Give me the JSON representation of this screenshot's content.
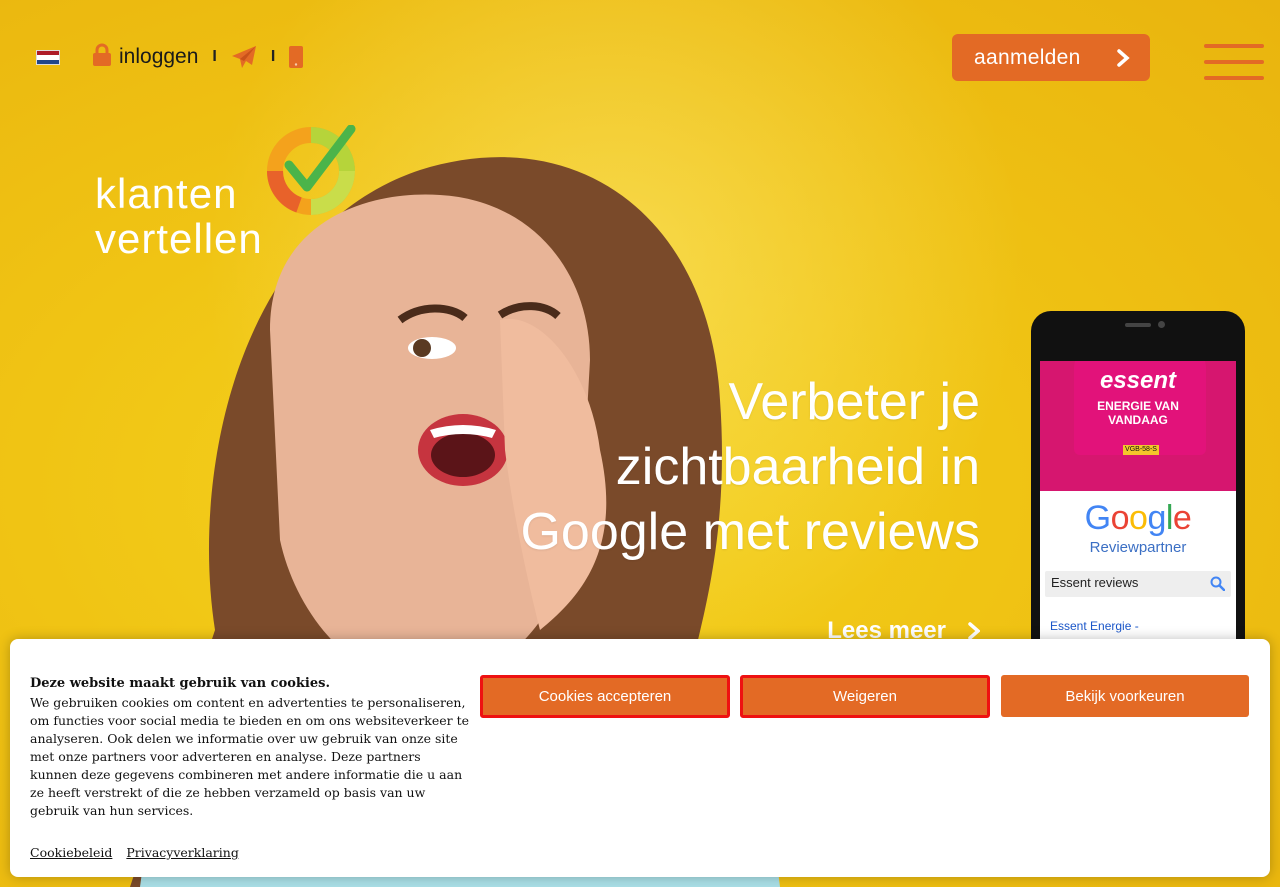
{
  "header": {
    "language_flag": "nl-flag",
    "login_label": "inloggen",
    "separator": "I",
    "signup_label": "aanmelden",
    "accent_color": "#e36a25"
  },
  "logo": {
    "word1": "klanten",
    "word2": "vertellen"
  },
  "hero": {
    "headline_lines": [
      "Verbeter je",
      "zichtbaarheid in",
      "Google met reviews"
    ],
    "read_more_label": "Lees meer"
  },
  "phone": {
    "brand": "essent",
    "tagline_line1": "ENERGIE VAN",
    "tagline_line2": "VANDAAG",
    "plate": "VGB-58-S",
    "google_letters": [
      "G",
      "o",
      "o",
      "g",
      "l",
      "e"
    ],
    "reviewpartner": "Reviewpartner",
    "search_query": "Essent reviews",
    "result": "Essent Energie -"
  },
  "cookie": {
    "title": "Deze website maakt gebruik van cookies.",
    "body": "We gebruiken cookies om content en advertenties te personaliseren, om functies voor social media te bieden en om ons websiteverkeer te analyseren. Ook delen we informatie over uw gebruik van onze site met onze partners voor adverteren en analyse. Deze partners kunnen deze gegevens combineren met andere informatie die u aan ze heeft verstrekt of die ze hebben verzameld op basis van uw gebruik van hun services.",
    "accept_label": "Cookies accepteren",
    "reject_label": "Weigeren",
    "prefs_label": "Bekijk voorkeuren",
    "policy_link": "Cookiebeleid",
    "privacy_link": "Privacyverklaring"
  }
}
